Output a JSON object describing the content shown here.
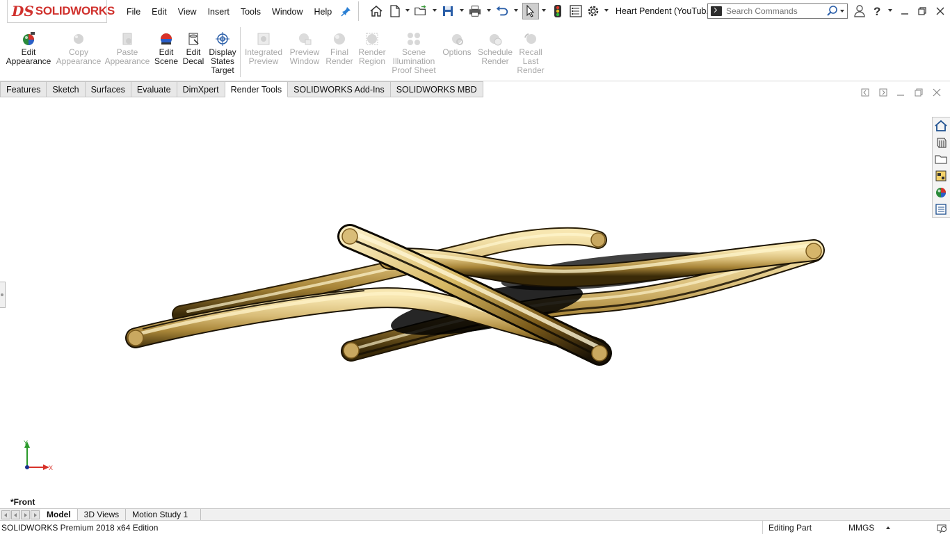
{
  "app": {
    "brand_prefix": "DS",
    "brand_name": "SOLIDWORKS"
  },
  "menu": [
    "File",
    "Edit",
    "View",
    "Insert",
    "Tools",
    "Window",
    "Help"
  ],
  "document_title": "Heart Pendent (YouTub...",
  "search": {
    "placeholder": "Search Commands"
  },
  "command_manager": {
    "buttons": [
      {
        "label": "Edit\nAppearance",
        "enabled": true,
        "icon": "edit-appearance-icon"
      },
      {
        "label": "Copy\nAppearance",
        "enabled": false,
        "icon": "copy-appearance-icon"
      },
      {
        "label": "Paste\nAppearance",
        "enabled": false,
        "icon": "paste-appearance-icon"
      },
      {
        "label": "Edit\nScene",
        "enabled": true,
        "icon": "edit-scene-icon"
      },
      {
        "label": "Edit\nDecal",
        "enabled": true,
        "icon": "edit-decal-icon"
      },
      {
        "label": "Display\nStates\nTarget",
        "enabled": true,
        "icon": "display-states-target-icon"
      },
      {
        "label": "Integrated\nPreview",
        "enabled": false,
        "icon": "integrated-preview-icon"
      },
      {
        "label": "Preview\nWindow",
        "enabled": false,
        "icon": "preview-window-icon"
      },
      {
        "label": "Final\nRender",
        "enabled": false,
        "icon": "final-render-icon"
      },
      {
        "label": "Render\nRegion",
        "enabled": false,
        "icon": "render-region-icon"
      },
      {
        "label": "Scene\nIllumination\nProof Sheet",
        "enabled": false,
        "icon": "scene-illumination-icon"
      },
      {
        "label": "Options",
        "enabled": false,
        "icon": "options-icon"
      },
      {
        "label": "Schedule\nRender",
        "enabled": false,
        "icon": "schedule-render-icon"
      },
      {
        "label": "Recall\nLast\nRender",
        "enabled": false,
        "icon": "recall-last-render-icon"
      }
    ]
  },
  "tabs": [
    {
      "label": "Features",
      "active": false
    },
    {
      "label": "Sketch",
      "active": false
    },
    {
      "label": "Surfaces",
      "active": false
    },
    {
      "label": "Evaluate",
      "active": false
    },
    {
      "label": "DimXpert",
      "active": false
    },
    {
      "label": "Render Tools",
      "active": true
    },
    {
      "label": "SOLIDWORKS Add-Ins",
      "active": false
    },
    {
      "label": "SOLIDWORKS MBD",
      "active": false
    }
  ],
  "triad": {
    "y_label": "Y",
    "x_label": "X"
  },
  "view_name": "*Front",
  "bottom_tabs": [
    {
      "label": "Model",
      "active": true
    },
    {
      "label": "3D Views",
      "active": false
    },
    {
      "label": "Motion Study 1",
      "active": false
    }
  ],
  "status": {
    "edition": "SOLIDWORKS Premium 2018 x64 Edition",
    "mode": "Editing Part",
    "units": "MMGS"
  },
  "colors": {
    "brand_red": "#d0312d",
    "gold_light": "#f4e1a8",
    "gold_mid": "#c9a85a",
    "gold_dark": "#5a4312"
  }
}
